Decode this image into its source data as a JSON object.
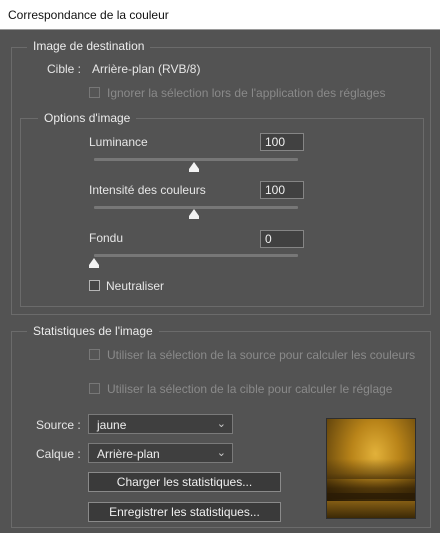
{
  "window": {
    "title": "Correspondance de la couleur"
  },
  "destination": {
    "legend": "Image de destination",
    "target_label": "Cible :",
    "target_value": "Arrière-plan (RVB/8)",
    "ignore_selection_label": "Ignorer la sélection lors de l'application des réglages"
  },
  "options": {
    "legend": "Options d'image",
    "luminance": {
      "label": "Luminance",
      "value": "100",
      "level": 0.5
    },
    "intensity": {
      "label": "Intensité des couleurs",
      "value": "100",
      "level": 0.5
    },
    "fade": {
      "label": "Fondu",
      "value": "0",
      "level": 0.0
    },
    "neutralize_label": "Neutraliser"
  },
  "stats": {
    "legend": "Statistiques de l'image",
    "use_source_selection_label": "Utiliser la sélection de la source pour calculer les couleurs",
    "use_target_selection_label": "Utiliser la sélection de la cible pour calculer le réglage",
    "source_label": "Source :",
    "source_value": "jaune",
    "layer_label": "Calque :",
    "layer_value": "Arrière-plan",
    "load_button": "Charger les statistiques...",
    "save_button": "Enregistrer les statistiques..."
  },
  "icons": {
    "dropdown": "chevron-down-icon",
    "slider_thumb": "triangle-thumb-icon"
  },
  "colors": {
    "background": "#535353",
    "text": "#e6e6e6",
    "disabled_text": "#8a8a8a",
    "titlebar": "#ffffff"
  }
}
